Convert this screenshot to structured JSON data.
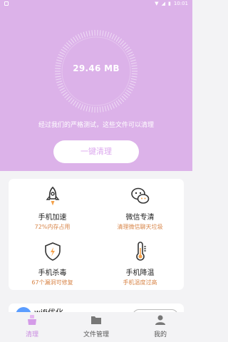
{
  "status": {
    "time": "10:01"
  },
  "hero": {
    "size": "29.46 MB",
    "tested_text": "经过我们的严格测试，这些文件可以清理",
    "clean_button": "一键清理"
  },
  "tools": [
    {
      "title": "手机加速",
      "subtitle": "72%内存占用",
      "icon": "rocket-icon"
    },
    {
      "title": "微信专清",
      "subtitle": "清理微信聊天垃圾",
      "icon": "wechat-icon"
    },
    {
      "title": "手机杀毒",
      "subtitle": "67个漏洞可修复",
      "icon": "shield-icon"
    },
    {
      "title": "手机降温",
      "subtitle": "手机温度过高",
      "icon": "thermometer-icon"
    }
  ],
  "peek": {
    "title": "wifi优化"
  },
  "tabs": [
    {
      "label": "清理",
      "icon": "broom-icon",
      "active": true
    },
    {
      "label": "文件管理",
      "icon": "folder-icon",
      "active": false
    },
    {
      "label": "我的",
      "icon": "person-icon",
      "active": false
    }
  ],
  "colors": {
    "hero_bg": "#dcb2e9",
    "accent": "#dca8ee",
    "subtitle": "#d8864a"
  }
}
